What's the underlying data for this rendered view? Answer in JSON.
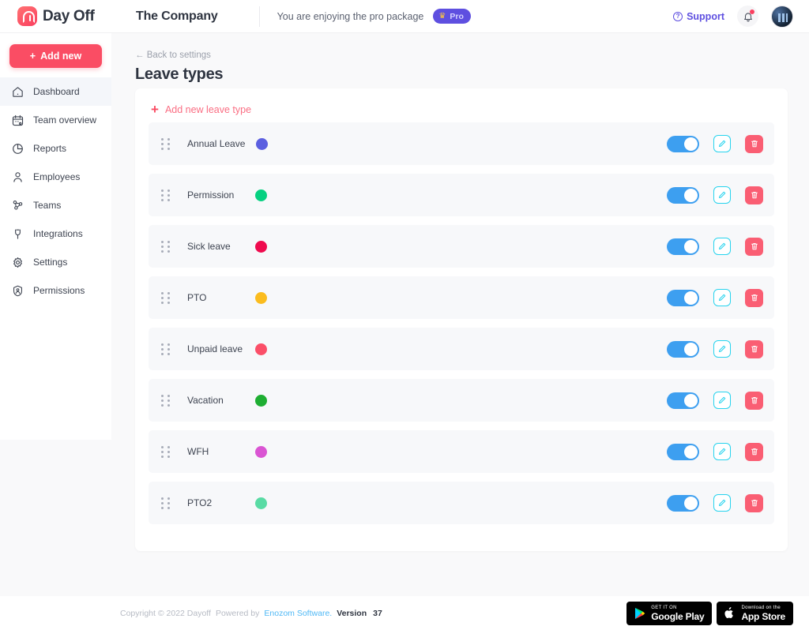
{
  "header": {
    "logo_text": "Day Off",
    "logo_icon": "dayoff-logo-icon",
    "company": "The Company",
    "package_message": "You are enjoying the pro package",
    "pro_badge": "Pro",
    "pro_badge_icon": "crown-icon",
    "support_label": "Support",
    "support_icon": "question-circle-icon",
    "bell_icon": "notification-bell-icon",
    "avatar_icon": "user-avatar"
  },
  "sidebar": {
    "add_new_label": "Add new",
    "items": [
      {
        "label": "Dashboard",
        "icon": "home-icon",
        "active": true
      },
      {
        "label": "Team overview",
        "icon": "calendar-icon",
        "active": false
      },
      {
        "label": "Reports",
        "icon": "pie-chart-icon",
        "active": false
      },
      {
        "label": "Employees",
        "icon": "user-icon",
        "active": false
      },
      {
        "label": "Teams",
        "icon": "users-group-icon",
        "active": false
      },
      {
        "label": "Integrations",
        "icon": "plug-icon",
        "active": false
      },
      {
        "label": "Settings",
        "icon": "gear-icon",
        "active": false
      },
      {
        "label": "Permissions",
        "icon": "badge-person-icon",
        "active": false
      }
    ]
  },
  "main": {
    "back_link": "← Back to settings",
    "page_title": "Leave types",
    "add_leave_type_label": "Add new leave type",
    "leave_types": [
      {
        "name": "Annual Leave",
        "color": "#5b5fe0",
        "enabled": true
      },
      {
        "name": "Permission",
        "color": "#07d181",
        "enabled": true
      },
      {
        "name": "Sick leave",
        "color": "#ef0b4e",
        "enabled": true
      },
      {
        "name": "PTO",
        "color": "#fbbc1e",
        "enabled": true
      },
      {
        "name": "Unpaid leave",
        "color": "#fb4f68",
        "enabled": true
      },
      {
        "name": "Vacation",
        "color": "#1eae32",
        "enabled": true
      },
      {
        "name": "WFH",
        "color": "#da55d3",
        "enabled": true
      },
      {
        "name": "PTO2",
        "color": "#59dba4",
        "enabled": true
      }
    ],
    "row_icons": {
      "drag": "drag-handle-icon",
      "toggle": "enabled-toggle",
      "edit": "edit-pencil-icon",
      "delete": "trash-icon"
    }
  },
  "footer": {
    "copyright": "Copyright © 2022 Dayoff",
    "powered_by": "Powered by",
    "company_link": "Enozom Software.",
    "version_label": "Version",
    "version_number": "37",
    "google_play": {
      "small": "GET IT ON",
      "large": "Google Play",
      "icon": "google-play-icon"
    },
    "app_store": {
      "small": "Download on the",
      "large": "App Store",
      "icon": "apple-icon"
    }
  },
  "colors": {
    "accent_red": "#fa4d64",
    "accent_purple": "#5e4fe0",
    "toggle_blue": "#3d9ff0",
    "edit_cyan": "#27d3ee",
    "delete_red": "#fa5e73",
    "link_blue": "#4fb8f5"
  }
}
